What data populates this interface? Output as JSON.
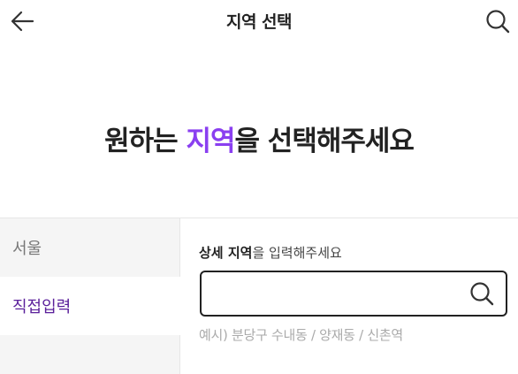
{
  "theme": {
    "accent": "#8a3ff0",
    "accent_dark": "#5a1f9a"
  },
  "header": {
    "back_icon": "arrow-left-icon",
    "title": "지역 선택",
    "search_icon": "search-icon"
  },
  "headline": {
    "before": "원하는 ",
    "accent": "지역",
    "after": "을 선택해주세요"
  },
  "sidebar": {
    "items": [
      {
        "label": "서울",
        "selected": false
      },
      {
        "label": "직접입력",
        "selected": true
      }
    ]
  },
  "detail": {
    "label_bold": "상세 지역",
    "label_rest": "을 입력해주세요",
    "input_value": "",
    "input_placeholder": "",
    "search_icon": "search-icon",
    "hint": "예시) 분당구 수내동 / 양재동 / 신촌역"
  }
}
